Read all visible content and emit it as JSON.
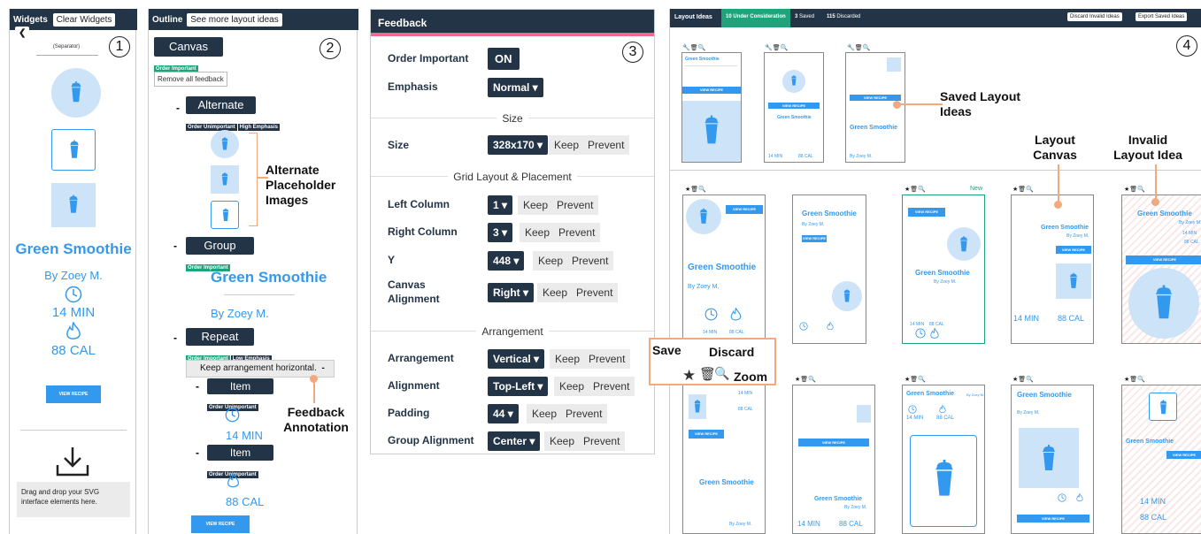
{
  "widgets": {
    "title": "Widgets",
    "clear_btn": "Clear Widgets",
    "separator": "(Separator)",
    "title_text": "Green Smoothie",
    "author": "By Zoey M.",
    "time": "14 MIN",
    "cal": "88 CAL",
    "view_btn": "VIEW RECIPE",
    "drop_text": "Drag and drop your SVG interface elements here.",
    "badge": "1"
  },
  "outline": {
    "title": "Outline",
    "more_btn": "See more layout ideas",
    "canvas": "Canvas",
    "remove_btn": "Remove all feedback",
    "alternate": "Alternate",
    "group": "Group",
    "repeat": "Repeat",
    "item": "Item",
    "title_text": "Green Smoothie",
    "author": "By Zoey M.",
    "time": "14 MIN",
    "cal": "88 CAL",
    "view_btn": "VIEW RECIPE",
    "keep_h": "Keep arrangement horizontal.",
    "minus": "-",
    "tags": {
      "oi": "Order Important",
      "ou": "Order Unimportant",
      "he": "High Emphasis",
      "le": "Low Emphasis"
    },
    "badge": "2"
  },
  "annotations": {
    "alt_images": "Alternate Placeholder Images",
    "feedback": "Feedback Annotation",
    "saved": "Saved Layout Ideas",
    "canvas": "Layout Canvas",
    "invalid": "Invalid Layout Idea",
    "save": "Save",
    "discard": "Discard",
    "zoom": "Zoom"
  },
  "feedback": {
    "title": "Feedback",
    "badge": "3",
    "order_lbl": "Order Important",
    "order_val": "ON",
    "emph_lbl": "Emphasis",
    "emph_val": "Normal",
    "size_sec": "Size",
    "size_lbl": "Size",
    "size_val": "328x170",
    "grid_sec": "Grid Layout & Placement",
    "left_lbl": "Left Column",
    "left_val": "1",
    "right_lbl": "Right Column",
    "right_val": "3",
    "y_lbl": "Y",
    "y_val": "448",
    "canvas_lbl": "Canvas Alignment",
    "canvas_val": "Right",
    "arr_sec": "Arrangement",
    "arr_lbl": "Arrangement",
    "arr_val": "Vertical",
    "align_lbl": "Alignment",
    "align_val": "Top-Left",
    "pad_lbl": "Padding",
    "pad_val": "44",
    "galign_lbl": "Group Alignment",
    "galign_val": "Center",
    "keep": "Keep",
    "prevent": "Prevent"
  },
  "ideas": {
    "title": "Layout Ideas",
    "under_num": "10",
    "under": "Under Consideration",
    "saved_num": "3",
    "saved": "Saved",
    "disc_num": "115",
    "disc": "Discarded",
    "discard_btn": "Discard Invalid Ideas",
    "export_btn": "Export Saved Ideas",
    "badge": "4",
    "new": "New",
    "title_text": "Green Smoothie",
    "author": "By Zoey M.",
    "time": "14 MIN",
    "cal": "88 CAL",
    "view_btn": "VIEW RECIPE"
  },
  "colors": {
    "navy": "#243447",
    "accent": "#3399ee",
    "green": "#1fa37a",
    "orange": "#f2a97e",
    "pink": "#ee6b8f"
  }
}
